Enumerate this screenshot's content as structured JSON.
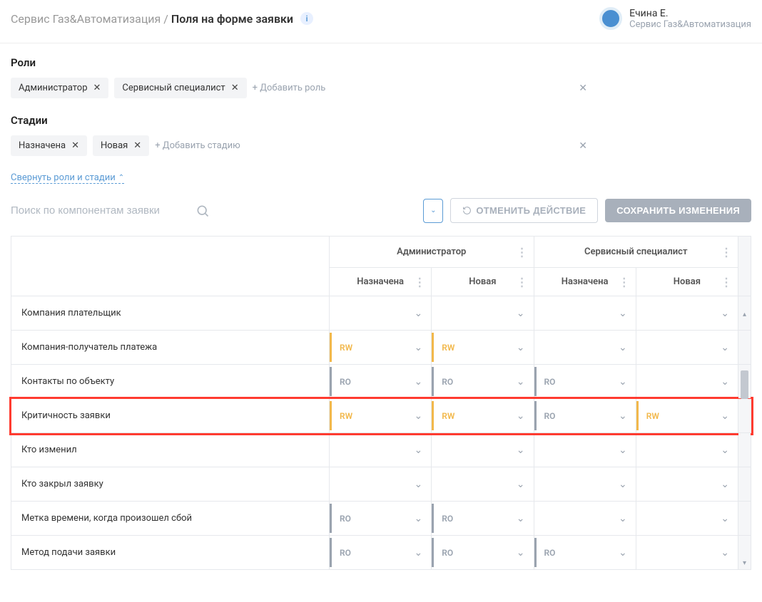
{
  "breadcrumb": {
    "parent": "Сервис Газ&Автоматизация /",
    "current": "Поля на форме заявки"
  },
  "user": {
    "name": "Ечина Е.",
    "org": "Сервис Газ&Автоматизация"
  },
  "roles": {
    "title": "Роли",
    "chips": [
      "Администратор",
      "Сервисный специалист"
    ],
    "add": "+ Добавить роль"
  },
  "stages": {
    "title": "Стадии",
    "chips": [
      "Назначена",
      "Новая"
    ],
    "add": "+ Добавить стадию"
  },
  "collapse": "Свернуть роли и стадии",
  "search": {
    "ph": "Поиск по компонентам заявки"
  },
  "btn": {
    "cancel": "ОТМЕНИТЬ ДЕЙСТВИЕ",
    "save": "СОХРАНИТЬ ИЗМЕНЕНИЯ"
  },
  "table": {
    "roles": [
      "Администратор",
      "Сервисный специалист"
    ],
    "stages": [
      "Назначена",
      "Новая",
      "Назначена",
      "Новая"
    ],
    "rows": [
      {
        "label": "Компания плательщик",
        "cells": [
          {},
          {},
          {},
          {}
        ]
      },
      {
        "label": "Компания-получатель платежа",
        "cells": [
          {
            "v": "RW",
            "c": "rw"
          },
          {
            "v": "RW",
            "c": "rw"
          },
          {},
          {}
        ]
      },
      {
        "label": "Контакты по объекту",
        "cells": [
          {
            "v": "RO",
            "c": "ro"
          },
          {
            "v": "RO",
            "c": "ro"
          },
          {
            "v": "RO",
            "c": "ro"
          },
          {}
        ]
      },
      {
        "label": "Критичность заявки",
        "cells": [
          {
            "v": "RW",
            "c": "rw"
          },
          {
            "v": "RW",
            "c": "rw"
          },
          {
            "v": "RO",
            "c": "ro"
          },
          {
            "v": "RW",
            "c": "rw"
          }
        ],
        "hl": true
      },
      {
        "label": "Кто изменил",
        "cells": [
          {},
          {},
          {},
          {}
        ]
      },
      {
        "label": "Кто закрыл заявку",
        "cells": [
          {},
          {},
          {},
          {}
        ]
      },
      {
        "label": "Метка времени, когда произошел сбой",
        "cells": [
          {
            "v": "RO",
            "c": "ro"
          },
          {
            "v": "RO",
            "c": "ro"
          },
          {},
          {}
        ]
      },
      {
        "label": "Метод подачи заявки",
        "cells": [
          {
            "v": "RO",
            "c": "ro"
          },
          {
            "v": "RO",
            "c": "ro"
          },
          {
            "v": "RO",
            "c": "ro"
          },
          {}
        ]
      }
    ]
  }
}
